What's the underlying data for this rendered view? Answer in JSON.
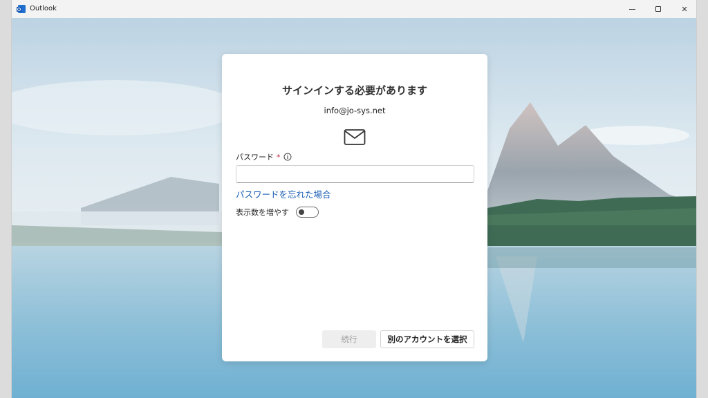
{
  "window": {
    "title": "Outlook",
    "icon": "outlook-app-icon"
  },
  "controls": {
    "minimize_icon": "minimize-icon",
    "maximize_icon": "maximize-icon",
    "close_icon": "close-icon",
    "close_glyph": "✕"
  },
  "dialog": {
    "title": "サインインする必要があります",
    "email": "info@jo-sys.net",
    "icon": "mail-icon",
    "password_label": "パスワード",
    "required_mark": "*",
    "password_value": "",
    "forgot_link": "パスワードを忘れた場合",
    "show_more_label": "表示数を増やす",
    "show_more_toggle": "off",
    "continue_button": "続行",
    "other_account_button": "別のアカウントを選択"
  },
  "colors": {
    "link": "#1a5fb4",
    "required": "#c4314b",
    "disabled_button_bg": "#eeeeee"
  }
}
